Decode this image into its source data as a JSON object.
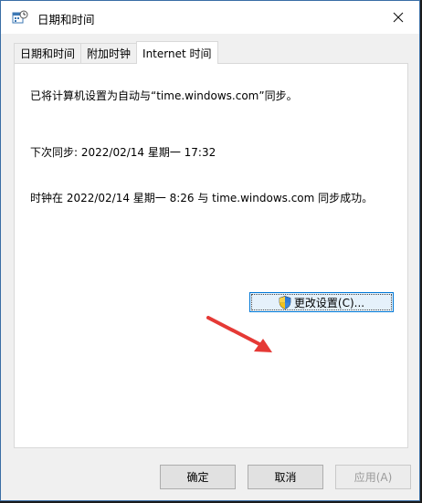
{
  "window": {
    "title": "日期和时间"
  },
  "tabs": [
    {
      "label": "日期和时间",
      "active": false
    },
    {
      "label": "附加时钟",
      "active": false
    },
    {
      "label": "Internet 时间",
      "active": true
    }
  ],
  "panel": {
    "sync_message": "已将计算机设置为自动与“time.windows.com”同步。",
    "next_sync": "下次同步: 2022/02/14 星期一 17:32",
    "last_sync_result": "时钟在 2022/02/14 星期一 8:26 与 time.windows.com 同步成功。",
    "change_settings_label": "更改设置(C)..."
  },
  "footer": {
    "ok_label": "确定",
    "cancel_label": "取消",
    "apply_label": "应用(A)"
  },
  "colors": {
    "accent": "#0078d7",
    "arrow": "#e53935"
  },
  "icons": {
    "app": "date-time-app-icon",
    "close": "close-icon",
    "shield": "uac-shield-icon"
  }
}
